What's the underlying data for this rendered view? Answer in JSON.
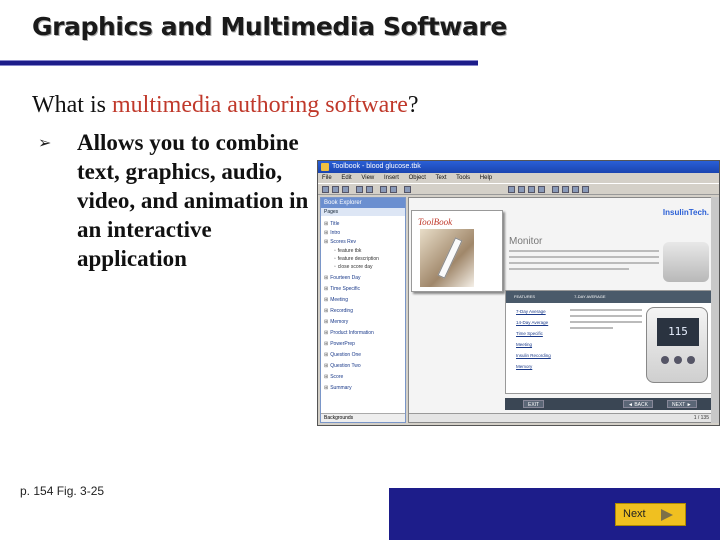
{
  "slide": {
    "title": "Graphics and Multimedia Software",
    "question_prefix": "What is ",
    "question_accent": "multimedia authoring software",
    "question_suffix": "?",
    "bullet": "Allows you to combine text, graphics, audio, video, and animation in an interactive application",
    "caption": "p. 154 Fig. 3-25",
    "next_label": "Next"
  },
  "colors": {
    "title_rule": "#1d1d8a",
    "accent": "#c0392b",
    "footer": "#1d1d8a",
    "next_button": "#f0c020"
  },
  "screenshot": {
    "window_title": "Toolbook - blood glucose.tbk",
    "menus": [
      "File",
      "Edit",
      "View",
      "Insert",
      "Object",
      "Text",
      "Tools",
      "Help"
    ],
    "panel_title": "Book Explorer",
    "panel_sub": "Pages",
    "tree": [
      {
        "label": "Title",
        "child": false
      },
      {
        "label": "Intro",
        "child": false
      },
      {
        "label": "Scores Rev",
        "child": false
      },
      {
        "label": "feature tbk",
        "child": true
      },
      {
        "label": "feature description",
        "child": true
      },
      {
        "label": "close score day",
        "child": true
      },
      {
        "label": "Fourteen Day",
        "child": false
      },
      {
        "label": "Time Specific",
        "child": false
      },
      {
        "label": "Meeting",
        "child": false
      },
      {
        "label": "Recording",
        "child": false
      },
      {
        "label": "Memory",
        "child": false
      },
      {
        "label": "Product Information",
        "child": false
      },
      {
        "label": "PowerPrep",
        "child": false
      },
      {
        "label": "Question One",
        "child": false
      },
      {
        "label": "Question Two",
        "child": false
      },
      {
        "label": "Score",
        "child": false
      },
      {
        "label": "Summary",
        "child": false
      }
    ],
    "panel_footer": "Backgrounds",
    "toolbook_logo": "ToolBook",
    "brand": "InsulinTech.",
    "monitor_label": "Monitor",
    "features_header": [
      "FEATURES",
      "7-DAY AVERAGE"
    ],
    "feature_links": [
      "7-Day Average",
      "14-Day Average",
      "Time Specific",
      "Meeting",
      "Insulin Recording",
      "Memory"
    ],
    "meter_reading": "115",
    "nav_exit": "EXIT",
    "nav_back": "◄ BACK",
    "nav_next": "NEXT ►",
    "status": "1 / 135"
  }
}
